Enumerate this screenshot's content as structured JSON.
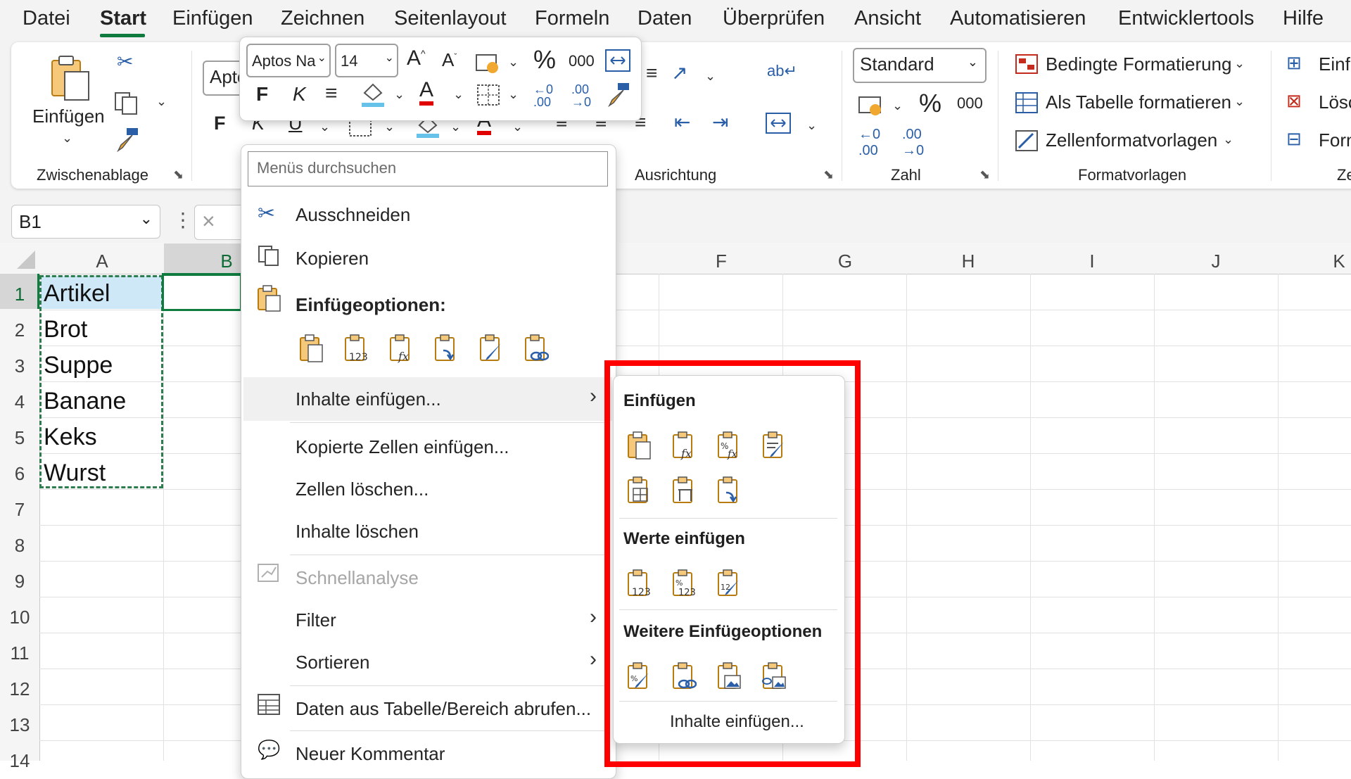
{
  "menu": {
    "tabs": [
      "Datei",
      "Start",
      "Einfügen",
      "Zeichnen",
      "Seitenlayout",
      "Formeln",
      "Daten",
      "Überprüfen",
      "Ansicht",
      "Automatisieren",
      "Entwicklertools",
      "Hilfe"
    ],
    "active": "Start"
  },
  "ribbon": {
    "clipboard": {
      "paste_label": "Einfügen",
      "group_label": "Zwischenablage"
    },
    "font": {
      "font_name_partial": "Apto",
      "bold": "F",
      "italic": "K",
      "underline": "U"
    },
    "alignment": {
      "group_label": "Ausrichtung"
    },
    "number": {
      "format_value": "Standard",
      "group_label": "Zahl",
      "thousands": "000"
    },
    "styles": {
      "conditional": "Bedingte Formatierung",
      "as_table": "Als Tabelle formatieren",
      "cell_styles": "Zellenformatvorlagen",
      "group_label": "Formatvorlagen"
    },
    "cells": {
      "insert": "Einfü",
      "delete": "Lösc",
      "format": "Forn",
      "group_label": "Ze"
    }
  },
  "mini_toolbar": {
    "font_name": "Aptos Na",
    "font_size": "14",
    "bold": "F",
    "italic": "K",
    "thousands": "000"
  },
  "formula_bar": {
    "name_box": "B1"
  },
  "grid": {
    "columns": [
      "A",
      "B",
      "F",
      "G",
      "H",
      "I",
      "J",
      "K"
    ],
    "rows": [
      "1",
      "2",
      "3",
      "4",
      "5",
      "6",
      "7",
      "8",
      "9",
      "10",
      "11",
      "12",
      "13",
      "14"
    ],
    "cells_a": [
      "Artikel",
      "Brot",
      "Suppe",
      "Banane",
      "Keks",
      "Wurst"
    ]
  },
  "context_menu": {
    "search_placeholder": "Menüs durchsuchen",
    "cut": "Ausschneiden",
    "copy": "Kopieren",
    "paste_options": "Einfügeoptionen:",
    "paste_special": "Inhalte einfügen...",
    "insert_copied": "Kopierte Zellen einfügen...",
    "delete_cells": "Zellen löschen...",
    "clear_contents": "Inhalte löschen",
    "quick_analysis": "Schnellanalyse",
    "filter": "Filter",
    "sort": "Sortieren",
    "get_data": "Daten aus Tabelle/Bereich abrufen...",
    "new_comment": "Neuer Kommentar"
  },
  "submenu": {
    "paste_title": "Einfügen",
    "values_title": "Werte einfügen",
    "more_title": "Weitere Einfügeoptionen",
    "paste_special": "Inhalte einfügen..."
  },
  "colors": {
    "accent": "#0f7b3f",
    "highlight": "#ff0000",
    "selection": "#cfe8f8",
    "clipboard": "#f0a830"
  }
}
